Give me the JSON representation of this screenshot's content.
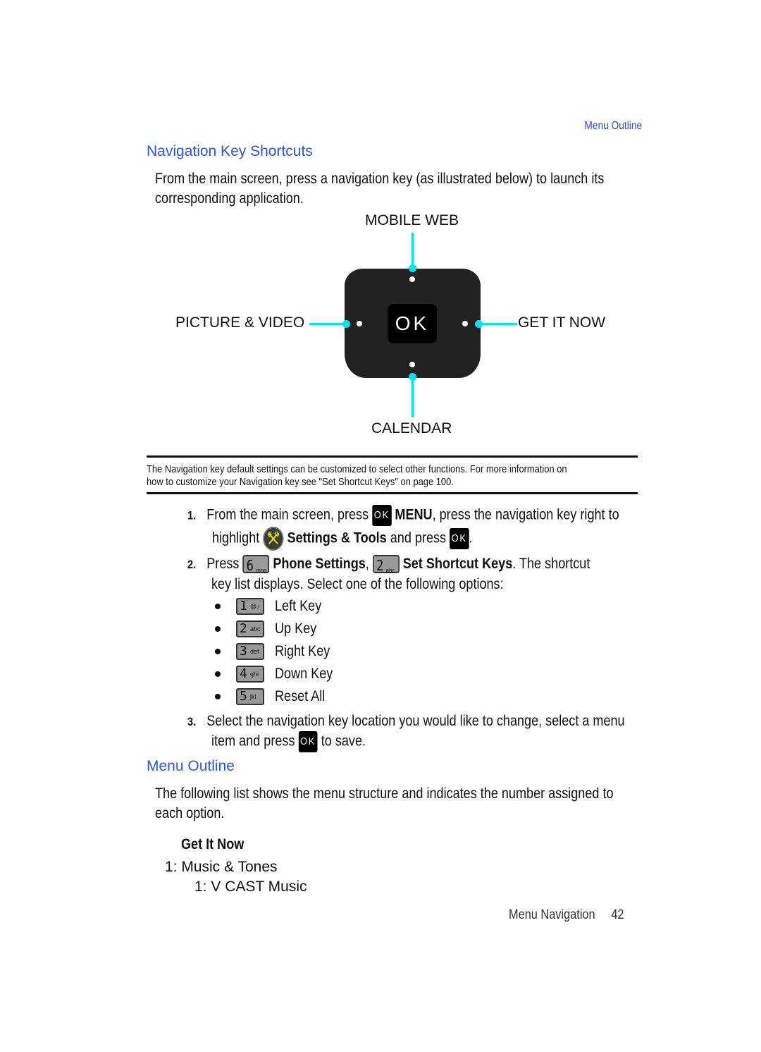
{
  "running_header": "Menu Outline",
  "section1": {
    "title": "Navigation Key Shortcuts",
    "intro_line1": "From the main screen, press a navigation key (as illustrated below) to launch its",
    "intro_line2": "corresponding application."
  },
  "diagram": {
    "up": "MOBILE WEB",
    "left": "PICTURE & VIDEO",
    "right": "GET IT NOW",
    "down": "CALENDAR",
    "center": "OK",
    "accent_color": "#00e5f0"
  },
  "note": {
    "line1": "The Navigation key default settings can be customized to select other functions. For more information on",
    "line2_pre": "how to customize your Navigation key see \"",
    "line2_link": "Set Shortcut Keys",
    "line2_post": "\" on page 100."
  },
  "steps": [
    {
      "num": "1.",
      "a": "From the main screen, press",
      "key": "OK",
      "b": "MENU",
      "c": ", press the navigation key right to",
      "d": "highlight",
      "e": "Settings & Tools",
      "f": "and press",
      "g": "."
    },
    {
      "num": "2.",
      "a": "Press",
      "key1_num": "6",
      "key1_letters": "mno",
      "b": "Phone Settings",
      "c": ",",
      "key2_num": "2",
      "key2_letters": "abc",
      "d": "Set Shortcut Keys",
      "e": ". The shortcut",
      "f": "key list displays. Select one of the following options:"
    },
    {
      "num": "3.",
      "a": "Select the navigation key location you would like to change, select a menu",
      "b": "item and press",
      "key": "OK",
      "c": "to save."
    }
  ],
  "options": [
    {
      "key_num": "1",
      "key_letters": "@♪",
      "label": "Left Key"
    },
    {
      "key_num": "2",
      "key_letters": "abc",
      "label": "Up Key"
    },
    {
      "key_num": "3",
      "key_letters": "def",
      "label": "Right Key"
    },
    {
      "key_num": "4",
      "key_letters": "ghi",
      "label": "Down Key"
    },
    {
      "key_num": "5",
      "key_letters": "jkl",
      "label": "Reset All"
    }
  ],
  "section2": {
    "title": "Menu Outline",
    "intro_line1": "The following list shows the menu structure and indicates the number assigned to",
    "intro_line2": "each option.",
    "group_title": "Get It Now",
    "items": [
      {
        "text": "1: Music & Tones",
        "level": 1
      },
      {
        "text": "1: V CAST Music",
        "level": 2
      }
    ]
  },
  "footer": {
    "section": "Menu Navigation",
    "page": "42"
  },
  "colors": {
    "heading_blue": "#2a55f0",
    "accent_cyan": "#00e5f0"
  }
}
